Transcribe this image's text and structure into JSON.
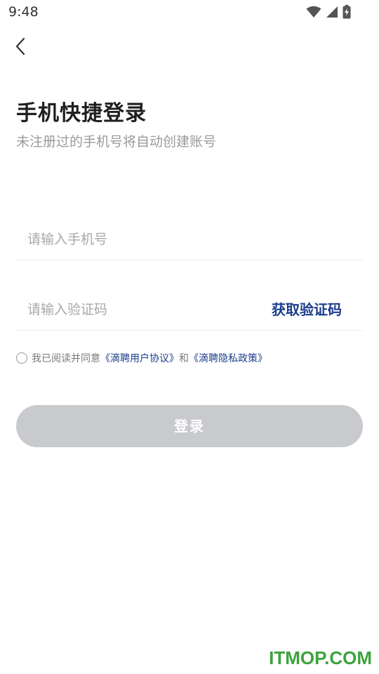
{
  "status_bar": {
    "time": "9:48",
    "icons": [
      "wifi-icon",
      "signal-icon",
      "battery-charging-icon"
    ]
  },
  "header": {
    "back_icon": "chevron-left-icon",
    "title": "手机快捷登录",
    "subtitle": "未注册过的手机号将自动创建账号"
  },
  "form": {
    "phone_placeholder": "请输入手机号",
    "code_placeholder": "请输入验证码",
    "get_code_label": "获取验证码"
  },
  "agreement": {
    "prefix": "我已阅读并同意",
    "user_agreement": "《滴聘用户协议》",
    "conjunction": "和",
    "privacy_policy": "《滴聘隐私政策》"
  },
  "login": {
    "label": "登录"
  },
  "watermark": "ITMOP.COM",
  "colors": {
    "link": "#1c3d8c",
    "button_disabled": "#c9cace",
    "watermark": "#3ca43c"
  }
}
